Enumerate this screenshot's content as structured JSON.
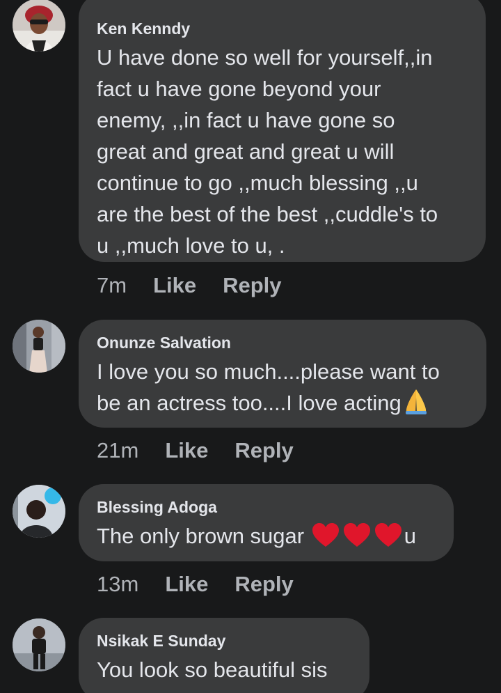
{
  "comments": [
    {
      "author": "Ken Kenndy",
      "text": "U have done so well for yourself,,in\nfact u have gone beyond your\nenemy,  ,,in fact u have gone so\ngreat and great and great u will\ncontinue to go ,,much blessing ,,u\nare the best of the best ,,cuddle's to\nu ,,much love to u, .",
      "time": "7m",
      "like_label": "Like",
      "reply_label": "Reply",
      "avatar_icon": "profile-photo"
    },
    {
      "author": "Onunze Salvation",
      "text": "I love you so much....please want to\nbe an actress too....I love acting",
      "emoji": "folded-hands-emoji",
      "time": "21m",
      "like_label": "Like",
      "reply_label": "Reply",
      "avatar_icon": "profile-photo"
    },
    {
      "author": "Blessing Adoga",
      "text_before": "The only brown sugar ",
      "emoji": "red-heart-emoji x3",
      "text_after": "u",
      "time": "13m",
      "like_label": "Like",
      "reply_label": "Reply",
      "avatar_icon": "profile-photo"
    },
    {
      "author": "Nsikak E Sunday",
      "text": "You look so beautiful sis",
      "avatar_icon": "profile-photo"
    }
  ],
  "colors": {
    "background": "#18191a",
    "bubble": "#3a3b3c",
    "text": "#e4e6eb",
    "meta": "#b0b3b8",
    "heart": "#e0162b"
  }
}
